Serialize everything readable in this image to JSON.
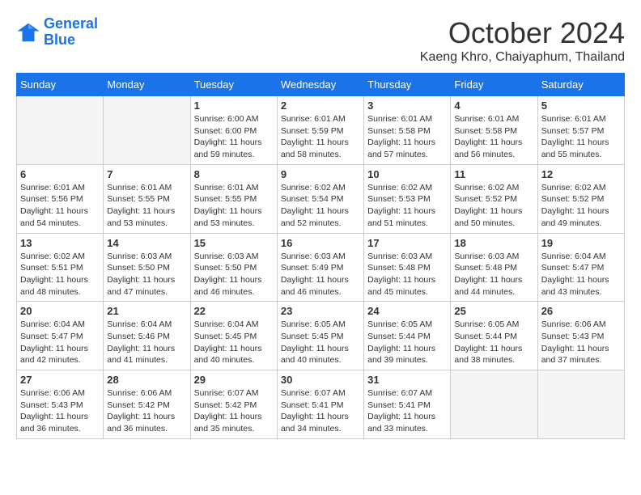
{
  "header": {
    "logo_line1": "General",
    "logo_line2": "Blue",
    "month": "October 2024",
    "location": "Kaeng Khro, Chaiyaphum, Thailand"
  },
  "weekdays": [
    "Sunday",
    "Monday",
    "Tuesday",
    "Wednesday",
    "Thursday",
    "Friday",
    "Saturday"
  ],
  "weeks": [
    [
      {
        "day": "",
        "empty": true
      },
      {
        "day": "",
        "empty": true
      },
      {
        "day": "1",
        "sunrise": "6:00 AM",
        "sunset": "6:00 PM",
        "daylight": "11 hours and 59 minutes."
      },
      {
        "day": "2",
        "sunrise": "6:01 AM",
        "sunset": "5:59 PM",
        "daylight": "11 hours and 58 minutes."
      },
      {
        "day": "3",
        "sunrise": "6:01 AM",
        "sunset": "5:58 PM",
        "daylight": "11 hours and 57 minutes."
      },
      {
        "day": "4",
        "sunrise": "6:01 AM",
        "sunset": "5:58 PM",
        "daylight": "11 hours and 56 minutes."
      },
      {
        "day": "5",
        "sunrise": "6:01 AM",
        "sunset": "5:57 PM",
        "daylight": "11 hours and 55 minutes."
      }
    ],
    [
      {
        "day": "6",
        "sunrise": "6:01 AM",
        "sunset": "5:56 PM",
        "daylight": "11 hours and 54 minutes."
      },
      {
        "day": "7",
        "sunrise": "6:01 AM",
        "sunset": "5:55 PM",
        "daylight": "11 hours and 53 minutes."
      },
      {
        "day": "8",
        "sunrise": "6:01 AM",
        "sunset": "5:55 PM",
        "daylight": "11 hours and 53 minutes."
      },
      {
        "day": "9",
        "sunrise": "6:02 AM",
        "sunset": "5:54 PM",
        "daylight": "11 hours and 52 minutes."
      },
      {
        "day": "10",
        "sunrise": "6:02 AM",
        "sunset": "5:53 PM",
        "daylight": "11 hours and 51 minutes."
      },
      {
        "day": "11",
        "sunrise": "6:02 AM",
        "sunset": "5:52 PM",
        "daylight": "11 hours and 50 minutes."
      },
      {
        "day": "12",
        "sunrise": "6:02 AM",
        "sunset": "5:52 PM",
        "daylight": "11 hours and 49 minutes."
      }
    ],
    [
      {
        "day": "13",
        "sunrise": "6:02 AM",
        "sunset": "5:51 PM",
        "daylight": "11 hours and 48 minutes."
      },
      {
        "day": "14",
        "sunrise": "6:03 AM",
        "sunset": "5:50 PM",
        "daylight": "11 hours and 47 minutes."
      },
      {
        "day": "15",
        "sunrise": "6:03 AM",
        "sunset": "5:50 PM",
        "daylight": "11 hours and 46 minutes."
      },
      {
        "day": "16",
        "sunrise": "6:03 AM",
        "sunset": "5:49 PM",
        "daylight": "11 hours and 46 minutes."
      },
      {
        "day": "17",
        "sunrise": "6:03 AM",
        "sunset": "5:48 PM",
        "daylight": "11 hours and 45 minutes."
      },
      {
        "day": "18",
        "sunrise": "6:03 AM",
        "sunset": "5:48 PM",
        "daylight": "11 hours and 44 minutes."
      },
      {
        "day": "19",
        "sunrise": "6:04 AM",
        "sunset": "5:47 PM",
        "daylight": "11 hours and 43 minutes."
      }
    ],
    [
      {
        "day": "20",
        "sunrise": "6:04 AM",
        "sunset": "5:47 PM",
        "daylight": "11 hours and 42 minutes."
      },
      {
        "day": "21",
        "sunrise": "6:04 AM",
        "sunset": "5:46 PM",
        "daylight": "11 hours and 41 minutes."
      },
      {
        "day": "22",
        "sunrise": "6:04 AM",
        "sunset": "5:45 PM",
        "daylight": "11 hours and 40 minutes."
      },
      {
        "day": "23",
        "sunrise": "6:05 AM",
        "sunset": "5:45 PM",
        "daylight": "11 hours and 40 minutes."
      },
      {
        "day": "24",
        "sunrise": "6:05 AM",
        "sunset": "5:44 PM",
        "daylight": "11 hours and 39 minutes."
      },
      {
        "day": "25",
        "sunrise": "6:05 AM",
        "sunset": "5:44 PM",
        "daylight": "11 hours and 38 minutes."
      },
      {
        "day": "26",
        "sunrise": "6:06 AM",
        "sunset": "5:43 PM",
        "daylight": "11 hours and 37 minutes."
      }
    ],
    [
      {
        "day": "27",
        "sunrise": "6:06 AM",
        "sunset": "5:43 PM",
        "daylight": "11 hours and 36 minutes."
      },
      {
        "day": "28",
        "sunrise": "6:06 AM",
        "sunset": "5:42 PM",
        "daylight": "11 hours and 36 minutes."
      },
      {
        "day": "29",
        "sunrise": "6:07 AM",
        "sunset": "5:42 PM",
        "daylight": "11 hours and 35 minutes."
      },
      {
        "day": "30",
        "sunrise": "6:07 AM",
        "sunset": "5:41 PM",
        "daylight": "11 hours and 34 minutes."
      },
      {
        "day": "31",
        "sunrise": "6:07 AM",
        "sunset": "5:41 PM",
        "daylight": "11 hours and 33 minutes."
      },
      {
        "day": "",
        "empty": true
      },
      {
        "day": "",
        "empty": true
      }
    ]
  ]
}
